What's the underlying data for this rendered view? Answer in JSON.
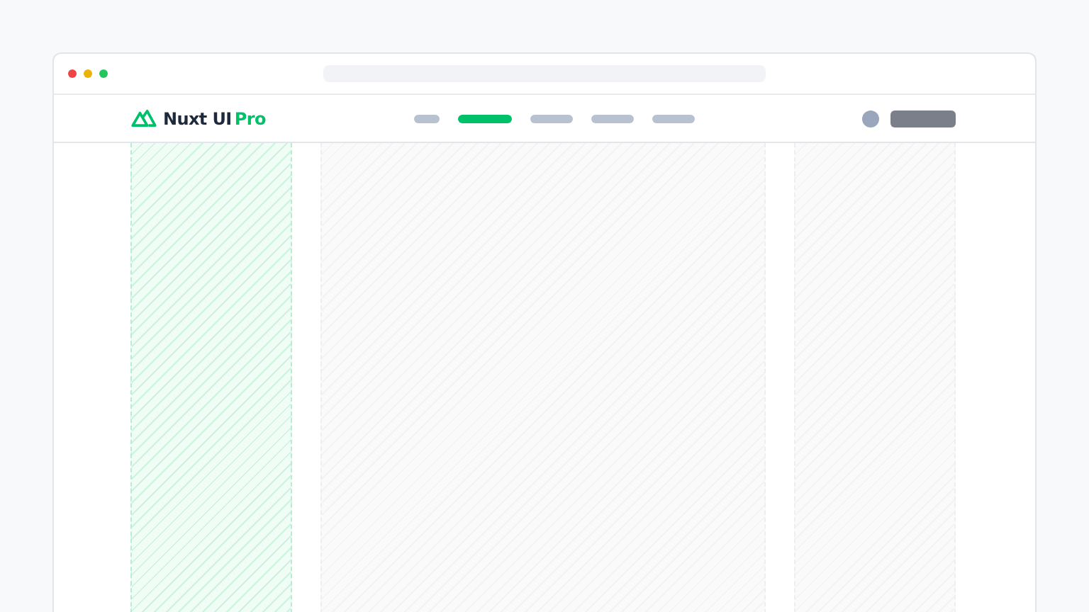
{
  "header": {
    "logo": {
      "name": "Nuxt UI",
      "suffix": "Pro"
    },
    "nav_items": [
      {
        "selected": false
      },
      {
        "selected": true
      },
      {
        "selected": false
      },
      {
        "selected": false
      },
      {
        "selected": false
      }
    ]
  },
  "columns": [
    {
      "highlighted": true
    },
    {
      "highlighted": false
    },
    {
      "highlighted": false
    }
  ]
}
